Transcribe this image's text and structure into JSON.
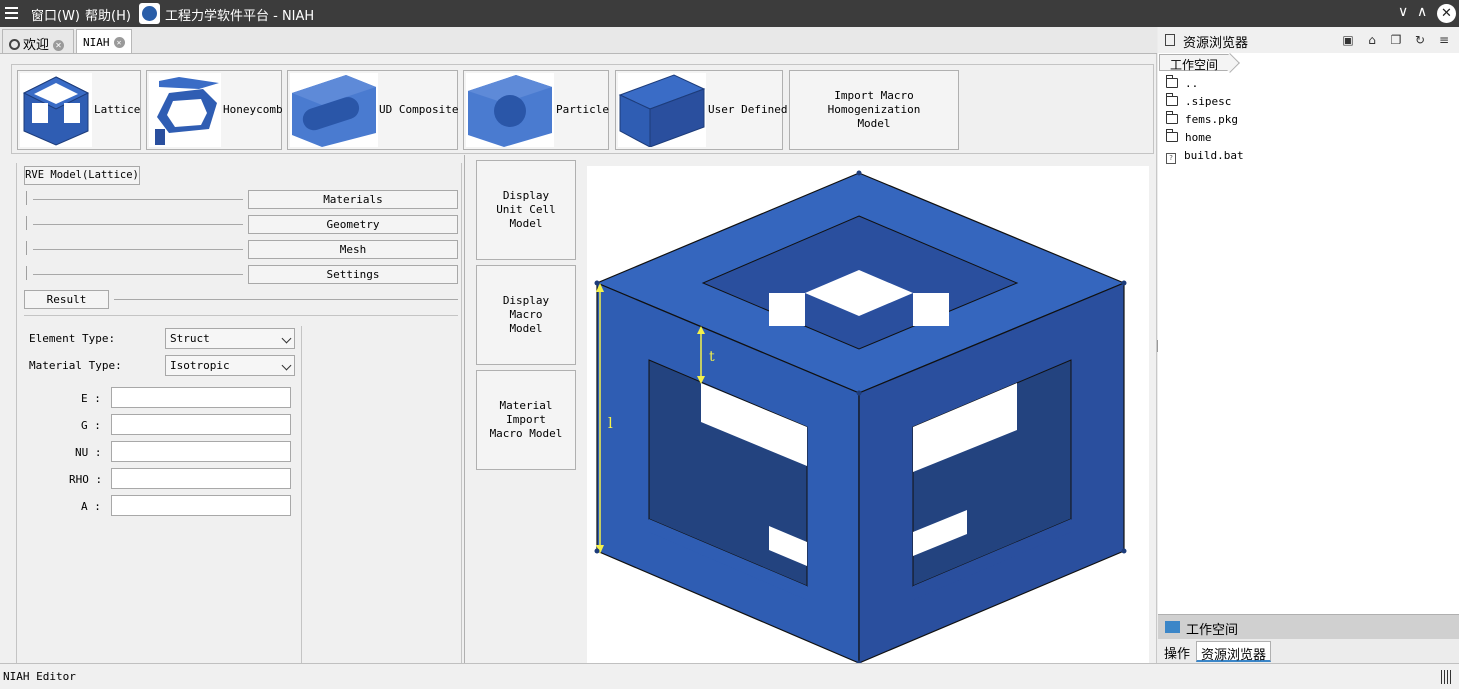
{
  "titlebar": {
    "menus": [
      "窗口(W)",
      "帮助(H)"
    ],
    "title": "工程力学软件平台 - NIAH",
    "minimize": "∨",
    "maximize": "∧",
    "close": "✕"
  },
  "tabs": [
    {
      "label": "欢迎",
      "close": "⊗"
    },
    {
      "label": "NIAH",
      "close": "⊗"
    }
  ],
  "models": [
    {
      "label": "Lattice",
      "icon": "lattice-cube-icon"
    },
    {
      "label": "Honeycomb",
      "icon": "honeycomb-icon"
    },
    {
      "label": "UD Composite",
      "icon": "ud-composite-icon"
    },
    {
      "label": "Particle",
      "icon": "particle-icon"
    },
    {
      "label": "User Defined",
      "icon": "user-defined-box-icon"
    },
    {
      "label": "Import Macro Homogenization Model"
    }
  ],
  "rve": {
    "title": "RVE Model(Lattice)",
    "steps": [
      "Materials",
      "Geometry",
      "Mesh",
      "Settings"
    ],
    "result": "Result"
  },
  "form": {
    "element_type_label": "Element Type:",
    "element_type_value": "Struct",
    "material_type_label": "Material Type:",
    "material_type_value": "Isotropic",
    "props": [
      "E :",
      "G :",
      "NU :",
      "RHO :",
      "A :"
    ]
  },
  "actions": [
    "Display Unit Cell Model",
    "Display Macro Model",
    "Material Import Macro Model"
  ],
  "preview": {
    "dim_t": "t",
    "dim_l": "l",
    "colors": {
      "front": "#2f5db3",
      "top": "#3566be",
      "right": "#2a4f9e",
      "dark": "#23437f",
      "dim": "#f4f14b"
    }
  },
  "browser": {
    "title": "资源浏览器",
    "crumb": "工作空间",
    "files": [
      {
        "name": "..",
        "type": "folder"
      },
      {
        "name": ".sipesc",
        "type": "folder"
      },
      {
        "name": "fems.pkg",
        "type": "folder"
      },
      {
        "name": "home",
        "type": "folder"
      },
      {
        "name": "build.bat",
        "type": "file"
      }
    ],
    "workspace": "工作空间",
    "bottom_tabs": [
      "操作",
      "资源浏览器"
    ]
  },
  "status": "NIAH Editor"
}
